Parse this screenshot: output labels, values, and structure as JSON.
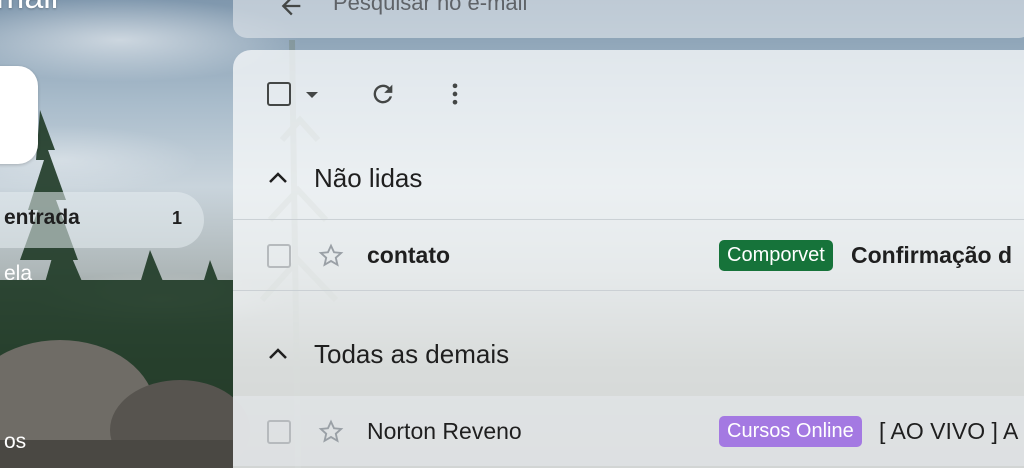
{
  "app": {
    "name": "mail"
  },
  "search": {
    "placeholder": "Pesquisar no e-mail",
    "back_icon": "arrow-back-icon"
  },
  "sidebar": {
    "items": [
      {
        "label": "entrada",
        "count": "1",
        "active": true
      },
      {
        "label": "ela",
        "count": "",
        "active": false
      },
      {
        "label": "os",
        "count": "",
        "active": false
      }
    ]
  },
  "toolbar": {
    "icons": [
      "checkbox-icon",
      "chevron-down-icon",
      "refresh-icon",
      "more-vert-icon"
    ]
  },
  "sections": [
    {
      "title": "Não lidas",
      "rows": [
        {
          "sender": "contato",
          "label": "Comporvet",
          "label_color": "#16733a",
          "subject": "Confirmação d",
          "unread": true
        }
      ]
    },
    {
      "title": "Todas as demais",
      "rows": [
        {
          "sender": "Norton Reveno",
          "label": "Cursos Online",
          "label_color": "#a479e2",
          "subject": "[ AO VIVO ] A",
          "unread": false
        }
      ]
    }
  ],
  "colors": {
    "accent_green": "#16733a",
    "accent_purple": "#a479e2",
    "icon": "#444746"
  }
}
